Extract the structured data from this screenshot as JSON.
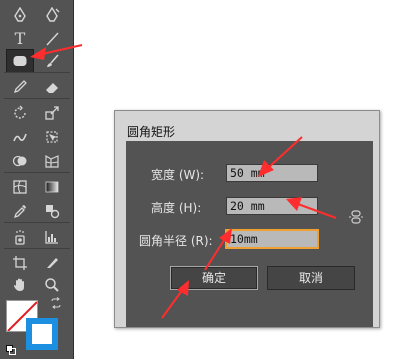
{
  "toolbar": {
    "tools": [
      {
        "left": "pen-tool-icon",
        "right": "curvature-pen-icon"
      },
      {
        "left": "type-tool-icon",
        "right": "line-segment-icon"
      },
      {
        "left": "rounded-rectangle-tool-icon",
        "right": "paintbrush-icon"
      },
      {
        "left": "pencil-tool-icon",
        "right": "eraser-tool-icon"
      },
      {
        "left": "rotate-tool-icon",
        "right": "scale-tool-icon"
      },
      {
        "left": "warp-tool-icon",
        "right": "free-transform-icon"
      },
      {
        "left": "shape-builder-icon",
        "right": "perspective-grid-icon"
      },
      {
        "left": "mesh-tool-icon",
        "right": "gradient-tool-icon"
      },
      {
        "left": "eyedropper-icon",
        "right": "blend-tool-icon"
      },
      {
        "left": "symbol-sprayer-icon",
        "right": "graph-tool-icon"
      },
      {
        "left": "artboard-tool-icon",
        "right": "slice-tool-icon"
      },
      {
        "left": "hand-tool-icon",
        "right": "zoom-tool-icon"
      }
    ],
    "type_glyph": "T"
  },
  "dialog": {
    "title": "圆角矩形",
    "width_label": "宽度 (W):",
    "width_value": "50 mm",
    "height_label": "高度 (H):",
    "height_value": "20 mm",
    "radius_label": "圆角半径 (R):",
    "radius_value": "10mm",
    "ok_label": "确定",
    "cancel_label": "取消"
  },
  "colors": {
    "toolbar_bg": "#535353",
    "dialog_panel": "#535353",
    "annotation_arrow": "#ff2d2d",
    "stroke_swatch": "#1c8fe0",
    "focus_border": "#f0a030"
  }
}
